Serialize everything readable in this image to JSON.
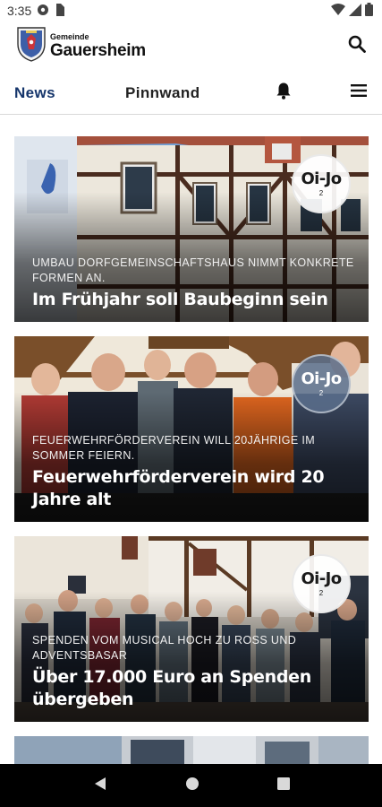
{
  "status_bar": {
    "time": "3:35",
    "left_icons": [
      "settings-icon",
      "sim-card-icon"
    ],
    "right_icons": [
      "wifi-icon",
      "signal-icon",
      "battery-icon"
    ]
  },
  "header": {
    "brand_small": "Gemeinde",
    "brand_big": "Gauersheim",
    "crest_icon": "coat-of-arms-icon",
    "search_icon": "search-icon"
  },
  "tabs": {
    "news": "News",
    "pinnwand": "Pinnwand",
    "bell_icon": "bell-icon",
    "menu_icon": "menu-icon",
    "active": "News",
    "accent_color": "#15356b"
  },
  "articles": [
    {
      "kicker": "Umbau Dorfgemeinschaftshaus nimmt konkrete Formen an.",
      "title": "Im Frühjahr soll Baubeginn sein",
      "badge": "Oi-Jo",
      "badge_num": "2"
    },
    {
      "kicker": "Feuerwehrförderverein will 20jährige im Sommer feiern.",
      "title": "Feuerwehrförderverein wird 20 Jahre alt",
      "badge": "Oi-Jo",
      "badge_num": "2"
    },
    {
      "kicker": "Spenden vom Musical Hoch zu Ross und Adventsbasar",
      "title": "Über 17.000 Euro an Spenden übergeben",
      "badge": "Oi-Jo",
      "badge_num": "2"
    }
  ],
  "system_nav": {
    "back_icon": "back-icon",
    "home_icon": "home-icon",
    "recents_icon": "recents-icon"
  }
}
